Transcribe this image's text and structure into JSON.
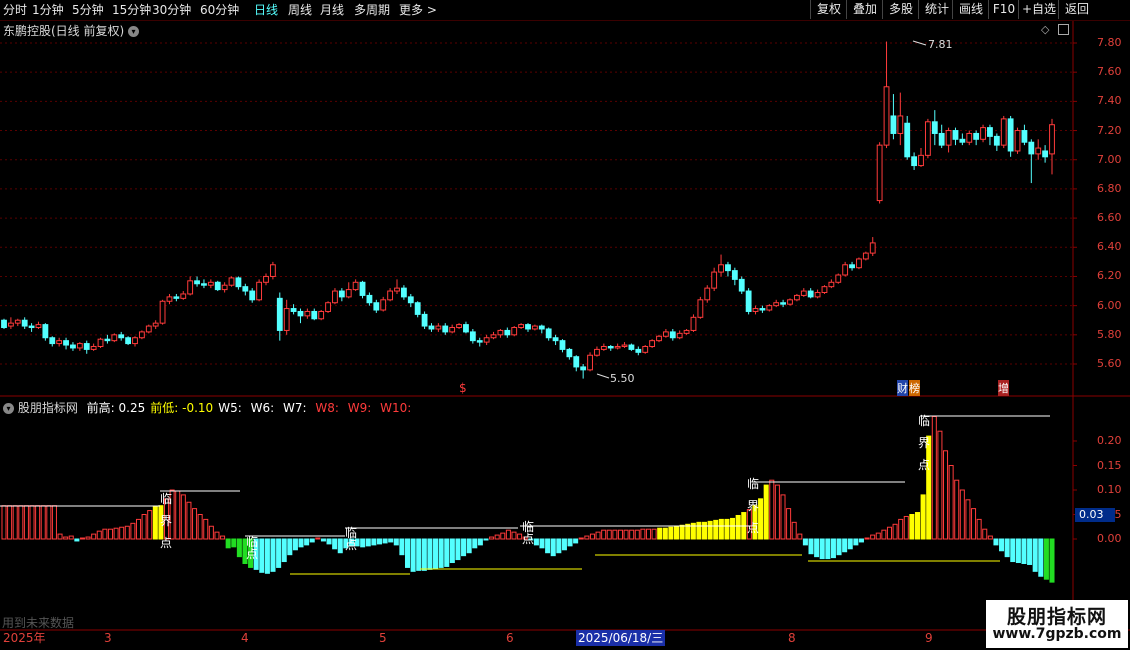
{
  "colors": {
    "bg": "#000000",
    "up": "#ff3b3b",
    "down": "#54ffff",
    "grid": "#5a0000",
    "axis": "#e0403a",
    "yellow": "#ffff00",
    "green": "#22dd22",
    "white": "#ffffff"
  },
  "toolbar": {
    "periods": [
      "分时",
      "1分钟",
      "5分钟",
      "15分钟",
      "30分钟",
      "60分钟",
      "日线",
      "周线",
      "月线",
      "多周期",
      "更多 >"
    ],
    "active_period": "日线",
    "right_buttons": [
      "复权",
      "叠加",
      "多股",
      "统计",
      "画线",
      "F10",
      "+自选",
      "返回"
    ]
  },
  "icons": {
    "menu": "chevron-down-icon",
    "diamond": "diamond-icon",
    "square": "square-icon"
  },
  "main_chart": {
    "title": "东鹏控股(日线 前复权)",
    "y_labels": [
      "7.80",
      "7.60",
      "7.40",
      "7.20",
      "7.00",
      "6.80",
      "6.60",
      "6.40",
      "6.20",
      "6.00",
      "5.80",
      "5.60"
    ],
    "high_label": "7.81",
    "low_label": "5.50",
    "markers": [
      {
        "text": "$"
      },
      {
        "text": "财"
      },
      {
        "text": "榜"
      },
      {
        "text": "增"
      }
    ]
  },
  "indicator": {
    "name": "股朋指标网",
    "items": [
      {
        "label": "前高:",
        "value": "0.25"
      },
      {
        "label": "前低:",
        "value": "-0.10"
      },
      {
        "label": "W5:",
        "value": ""
      },
      {
        "label": "W6:",
        "value": ""
      },
      {
        "label": "W7:",
        "value": ""
      },
      {
        "label": "W8:",
        "value": ""
      },
      {
        "label": "W9:",
        "value": ""
      },
      {
        "label": "W10:",
        "value": ""
      }
    ],
    "y_labels": [
      "0.20",
      "0.15",
      "0.10",
      "0.05",
      "0.00"
    ],
    "current_value": "0.03",
    "marks": [
      "临",
      "界",
      "点"
    ],
    "footer_note": "用到未来数据"
  },
  "date_axis": {
    "labels": [
      "2025年",
      "3",
      "4",
      "5",
      "6",
      "2025/06/18/三",
      "8",
      "9"
    ]
  },
  "watermark": {
    "line1": "股朋指标网",
    "line2": "www.7gpzb.com"
  },
  "chart_data": {
    "type": "candlestick",
    "series": [
      {
        "o": 5.9,
        "c": 5.85,
        "h": 5.91,
        "l": 5.84
      },
      {
        "o": 5.86,
        "c": 5.88,
        "h": 5.92,
        "l": 5.84
      },
      {
        "o": 5.88,
        "c": 5.9,
        "h": 5.91,
        "l": 5.86
      },
      {
        "o": 5.9,
        "c": 5.86,
        "h": 5.92,
        "l": 5.84
      },
      {
        "o": 5.86,
        "c": 5.85,
        "h": 5.88,
        "l": 5.82
      },
      {
        "o": 5.85,
        "c": 5.87,
        "h": 5.89,
        "l": 5.84
      },
      {
        "o": 5.87,
        "c": 5.78,
        "h": 5.88,
        "l": 5.76
      },
      {
        "o": 5.78,
        "c": 5.74,
        "h": 5.79,
        "l": 5.72
      },
      {
        "o": 5.74,
        "c": 5.76,
        "h": 5.78,
        "l": 5.72
      },
      {
        "o": 5.76,
        "c": 5.73,
        "h": 5.78,
        "l": 5.7
      },
      {
        "o": 5.73,
        "c": 5.71,
        "h": 5.75,
        "l": 5.69
      },
      {
        "o": 5.71,
        "c": 5.74,
        "h": 5.75,
        "l": 5.69
      },
      {
        "o": 5.74,
        "c": 5.7,
        "h": 5.76,
        "l": 5.67
      },
      {
        "o": 5.7,
        "c": 5.72,
        "h": 5.74,
        "l": 5.69
      },
      {
        "o": 5.72,
        "c": 5.77,
        "h": 5.78,
        "l": 5.71
      },
      {
        "o": 5.77,
        "c": 5.76,
        "h": 5.8,
        "l": 5.74
      },
      {
        "o": 5.76,
        "c": 5.8,
        "h": 5.81,
        "l": 5.75
      },
      {
        "o": 5.8,
        "c": 5.78,
        "h": 5.82,
        "l": 5.76
      },
      {
        "o": 5.78,
        "c": 5.74,
        "h": 5.79,
        "l": 5.73
      },
      {
        "o": 5.74,
        "c": 5.78,
        "h": 5.79,
        "l": 5.72
      },
      {
        "o": 5.78,
        "c": 5.82,
        "h": 5.83,
        "l": 5.77
      },
      {
        "o": 5.82,
        "c": 5.86,
        "h": 5.87,
        "l": 5.81
      },
      {
        "o": 5.86,
        "c": 5.88,
        "h": 5.9,
        "l": 5.84
      },
      {
        "o": 5.88,
        "c": 6.03,
        "h": 6.04,
        "l": 5.87
      },
      {
        "o": 6.03,
        "c": 6.06,
        "h": 6.08,
        "l": 6.01
      },
      {
        "o": 6.06,
        "c": 6.05,
        "h": 6.08,
        "l": 6.03
      },
      {
        "o": 6.05,
        "c": 6.08,
        "h": 6.1,
        "l": 6.04
      },
      {
        "o": 6.08,
        "c": 6.17,
        "h": 6.2,
        "l": 6.07
      },
      {
        "o": 6.17,
        "c": 6.15,
        "h": 6.2,
        "l": 6.13
      },
      {
        "o": 6.15,
        "c": 6.14,
        "h": 6.18,
        "l": 6.12
      },
      {
        "o": 6.14,
        "c": 6.16,
        "h": 6.18,
        "l": 6.12
      },
      {
        "o": 6.16,
        "c": 6.11,
        "h": 6.17,
        "l": 6.1
      },
      {
        "o": 6.11,
        "c": 6.14,
        "h": 6.16,
        "l": 6.09
      },
      {
        "o": 6.14,
        "c": 6.19,
        "h": 6.2,
        "l": 6.13
      },
      {
        "o": 6.19,
        "c": 6.13,
        "h": 6.2,
        "l": 6.11
      },
      {
        "o": 6.13,
        "c": 6.1,
        "h": 6.15,
        "l": 6.07
      },
      {
        "o": 6.1,
        "c": 6.04,
        "h": 6.12,
        "l": 6.02
      },
      {
        "o": 6.04,
        "c": 6.16,
        "h": 6.18,
        "l": 6.03
      },
      {
        "o": 6.16,
        "c": 6.2,
        "h": 6.22,
        "l": 6.14
      },
      {
        "o": 6.2,
        "c": 6.28,
        "h": 6.3,
        "l": 6.18
      },
      {
        "o": 6.05,
        "c": 5.83,
        "h": 6.09,
        "l": 5.76
      },
      {
        "o": 5.83,
        "c": 5.98,
        "h": 6.04,
        "l": 5.8
      },
      {
        "o": 5.98,
        "c": 5.96,
        "h": 6.01,
        "l": 5.94
      },
      {
        "o": 5.96,
        "c": 5.93,
        "h": 5.98,
        "l": 5.88
      },
      {
        "o": 5.93,
        "c": 5.96,
        "h": 5.98,
        "l": 5.91
      },
      {
        "o": 5.96,
        "c": 5.91,
        "h": 5.98,
        "l": 5.9
      },
      {
        "o": 5.91,
        "c": 5.96,
        "h": 5.97,
        "l": 5.9
      },
      {
        "o": 5.96,
        "c": 6.02,
        "h": 6.03,
        "l": 5.95
      },
      {
        "o": 6.02,
        "c": 6.1,
        "h": 6.12,
        "l": 6.01
      },
      {
        "o": 6.1,
        "c": 6.06,
        "h": 6.12,
        "l": 6.03
      },
      {
        "o": 6.06,
        "c": 6.11,
        "h": 6.16,
        "l": 6.05
      },
      {
        "o": 6.11,
        "c": 6.16,
        "h": 6.18,
        "l": 6.1
      },
      {
        "o": 6.16,
        "c": 6.07,
        "h": 6.17,
        "l": 6.05
      },
      {
        "o": 6.07,
        "c": 6.02,
        "h": 6.09,
        "l": 6.0
      },
      {
        "o": 6.02,
        "c": 5.97,
        "h": 6.04,
        "l": 5.95
      },
      {
        "o": 5.97,
        "c": 6.04,
        "h": 6.06,
        "l": 5.96
      },
      {
        "o": 6.04,
        "c": 6.1,
        "h": 6.12,
        "l": 6.03
      },
      {
        "o": 6.1,
        "c": 6.12,
        "h": 6.18,
        "l": 6.08
      },
      {
        "o": 6.12,
        "c": 6.06,
        "h": 6.14,
        "l": 6.04
      },
      {
        "o": 6.06,
        "c": 6.02,
        "h": 6.08,
        "l": 5.99
      },
      {
        "o": 6.02,
        "c": 5.94,
        "h": 6.03,
        "l": 5.92
      },
      {
        "o": 5.94,
        "c": 5.86,
        "h": 5.96,
        "l": 5.84
      },
      {
        "o": 5.86,
        "c": 5.84,
        "h": 5.88,
        "l": 5.82
      },
      {
        "o": 5.84,
        "c": 5.86,
        "h": 5.88,
        "l": 5.82
      },
      {
        "o": 5.86,
        "c": 5.82,
        "h": 5.88,
        "l": 5.8
      },
      {
        "o": 5.82,
        "c": 5.85,
        "h": 5.87,
        "l": 5.81
      },
      {
        "o": 5.85,
        "c": 5.87,
        "h": 5.88,
        "l": 5.84
      },
      {
        "o": 5.87,
        "c": 5.82,
        "h": 5.89,
        "l": 5.81
      },
      {
        "o": 5.82,
        "c": 5.76,
        "h": 5.84,
        "l": 5.74
      },
      {
        "o": 5.76,
        "c": 5.75,
        "h": 5.78,
        "l": 5.72
      },
      {
        "o": 5.75,
        "c": 5.78,
        "h": 5.8,
        "l": 5.73
      },
      {
        "o": 5.78,
        "c": 5.8,
        "h": 5.82,
        "l": 5.77
      },
      {
        "o": 5.8,
        "c": 5.83,
        "h": 5.84,
        "l": 5.78
      },
      {
        "o": 5.83,
        "c": 5.8,
        "h": 5.85,
        "l": 5.78
      },
      {
        "o": 5.8,
        "c": 5.85,
        "h": 5.86,
        "l": 5.79
      },
      {
        "o": 5.85,
        "c": 5.87,
        "h": 5.88,
        "l": 5.84
      },
      {
        "o": 5.87,
        "c": 5.84,
        "h": 5.88,
        "l": 5.82
      },
      {
        "o": 5.84,
        "c": 5.86,
        "h": 5.87,
        "l": 5.83
      },
      {
        "o": 5.86,
        "c": 5.84,
        "h": 5.87,
        "l": 5.81
      },
      {
        "o": 5.84,
        "c": 5.78,
        "h": 5.85,
        "l": 5.76
      },
      {
        "o": 5.78,
        "c": 5.76,
        "h": 5.8,
        "l": 5.73
      },
      {
        "o": 5.76,
        "c": 5.7,
        "h": 5.77,
        "l": 5.68
      },
      {
        "o": 5.7,
        "c": 5.65,
        "h": 5.71,
        "l": 5.63
      },
      {
        "o": 5.65,
        "c": 5.58,
        "h": 5.66,
        "l": 5.55
      },
      {
        "o": 5.58,
        "c": 5.56,
        "h": 5.6,
        "l": 5.5
      },
      {
        "o": 5.56,
        "c": 5.66,
        "h": 5.68,
        "l": 5.55
      },
      {
        "o": 5.66,
        "c": 5.7,
        "h": 5.72,
        "l": 5.65
      },
      {
        "o": 5.7,
        "c": 5.72,
        "h": 5.74,
        "l": 5.69
      },
      {
        "o": 5.72,
        "c": 5.71,
        "h": 5.73,
        "l": 5.69
      },
      {
        "o": 5.71,
        "c": 5.72,
        "h": 5.74,
        "l": 5.7
      },
      {
        "o": 5.72,
        "c": 5.73,
        "h": 5.75,
        "l": 5.71
      },
      {
        "o": 5.73,
        "c": 5.7,
        "h": 5.74,
        "l": 5.69
      },
      {
        "o": 5.7,
        "c": 5.68,
        "h": 5.72,
        "l": 5.66
      },
      {
        "o": 5.68,
        "c": 5.72,
        "h": 5.73,
        "l": 5.67
      },
      {
        "o": 5.72,
        "c": 5.76,
        "h": 5.77,
        "l": 5.71
      },
      {
        "o": 5.76,
        "c": 5.79,
        "h": 5.8,
        "l": 5.75
      },
      {
        "o": 5.79,
        "c": 5.82,
        "h": 5.84,
        "l": 5.78
      },
      {
        "o": 5.82,
        "c": 5.78,
        "h": 5.84,
        "l": 5.76
      },
      {
        "o": 5.78,
        "c": 5.81,
        "h": 5.83,
        "l": 5.77
      },
      {
        "o": 5.81,
        "c": 5.83,
        "h": 5.84,
        "l": 5.8
      },
      {
        "o": 5.83,
        "c": 5.92,
        "h": 5.94,
        "l": 5.82
      },
      {
        "o": 5.92,
        "c": 6.04,
        "h": 6.06,
        "l": 5.91
      },
      {
        "o": 6.04,
        "c": 6.12,
        "h": 6.14,
        "l": 6.02
      },
      {
        "o": 6.12,
        "c": 6.23,
        "h": 6.26,
        "l": 6.1
      },
      {
        "o": 6.23,
        "c": 6.28,
        "h": 6.35,
        "l": 6.2
      },
      {
        "o": 6.28,
        "c": 6.24,
        "h": 6.3,
        "l": 6.2
      },
      {
        "o": 6.24,
        "c": 6.18,
        "h": 6.26,
        "l": 6.14
      },
      {
        "o": 6.18,
        "c": 6.1,
        "h": 6.2,
        "l": 6.08
      },
      {
        "o": 6.1,
        "c": 5.96,
        "h": 6.12,
        "l": 5.94
      },
      {
        "o": 5.96,
        "c": 5.98,
        "h": 6.0,
        "l": 5.94
      },
      {
        "o": 5.98,
        "c": 5.97,
        "h": 6.0,
        "l": 5.95
      },
      {
        "o": 5.97,
        "c": 6.0,
        "h": 6.01,
        "l": 5.96
      },
      {
        "o": 6.0,
        "c": 6.02,
        "h": 6.04,
        "l": 5.99
      },
      {
        "o": 6.02,
        "c": 6.01,
        "h": 6.04,
        "l": 5.99
      },
      {
        "o": 6.01,
        "c": 6.04,
        "h": 6.05,
        "l": 6.0
      },
      {
        "o": 6.04,
        "c": 6.07,
        "h": 6.08,
        "l": 6.03
      },
      {
        "o": 6.07,
        "c": 6.1,
        "h": 6.12,
        "l": 6.06
      },
      {
        "o": 6.1,
        "c": 6.06,
        "h": 6.12,
        "l": 6.05
      },
      {
        "o": 6.06,
        "c": 6.09,
        "h": 6.11,
        "l": 6.05
      },
      {
        "o": 6.09,
        "c": 6.13,
        "h": 6.14,
        "l": 6.08
      },
      {
        "o": 6.13,
        "c": 6.16,
        "h": 6.18,
        "l": 6.12
      },
      {
        "o": 6.16,
        "c": 6.21,
        "h": 6.22,
        "l": 6.15
      },
      {
        "o": 6.21,
        "c": 6.28,
        "h": 6.3,
        "l": 6.2
      },
      {
        "o": 6.28,
        "c": 6.26,
        "h": 6.3,
        "l": 6.24
      },
      {
        "o": 6.26,
        "c": 6.32,
        "h": 6.33,
        "l": 6.25
      },
      {
        "o": 6.32,
        "c": 6.36,
        "h": 6.37,
        "l": 6.31
      },
      {
        "o": 6.36,
        "c": 6.43,
        "h": 6.47,
        "l": 6.34
      },
      {
        "o": 6.72,
        "c": 7.1,
        "h": 7.12,
        "l": 6.7
      },
      {
        "o": 7.1,
        "c": 7.5,
        "h": 7.81,
        "l": 7.08
      },
      {
        "o": 7.3,
        "c": 7.18,
        "h": 7.45,
        "l": 7.14
      },
      {
        "o": 7.18,
        "c": 7.3,
        "h": 7.46,
        "l": 7.1
      },
      {
        "o": 7.25,
        "c": 7.02,
        "h": 7.3,
        "l": 7.0
      },
      {
        "o": 7.02,
        "c": 6.96,
        "h": 7.05,
        "l": 6.93
      },
      {
        "o": 6.96,
        "c": 7.03,
        "h": 7.08,
        "l": 6.95
      },
      {
        "o": 7.03,
        "c": 7.26,
        "h": 7.28,
        "l": 7.01
      },
      {
        "o": 7.26,
        "c": 7.18,
        "h": 7.34,
        "l": 7.1
      },
      {
        "o": 7.18,
        "c": 7.1,
        "h": 7.24,
        "l": 7.08
      },
      {
        "o": 7.1,
        "c": 7.2,
        "h": 7.22,
        "l": 7.05
      },
      {
        "o": 7.2,
        "c": 7.14,
        "h": 7.22,
        "l": 7.1
      },
      {
        "o": 7.14,
        "c": 7.12,
        "h": 7.18,
        "l": 7.1
      },
      {
        "o": 7.12,
        "c": 7.18,
        "h": 7.2,
        "l": 7.1
      },
      {
        "o": 7.18,
        "c": 7.14,
        "h": 7.2,
        "l": 7.1
      },
      {
        "o": 7.14,
        "c": 7.22,
        "h": 7.24,
        "l": 7.12
      },
      {
        "o": 7.22,
        "c": 7.16,
        "h": 7.24,
        "l": 7.1
      },
      {
        "o": 7.16,
        "c": 7.1,
        "h": 7.18,
        "l": 7.06
      },
      {
        "o": 7.1,
        "c": 7.28,
        "h": 7.3,
        "l": 7.08
      },
      {
        "o": 7.28,
        "c": 7.06,
        "h": 7.3,
        "l": 7.02
      },
      {
        "o": 7.06,
        "c": 7.2,
        "h": 7.22,
        "l": 7.04
      },
      {
        "o": 7.2,
        "c": 7.12,
        "h": 7.24,
        "l": 7.1
      },
      {
        "o": 7.12,
        "c": 7.04,
        "h": 7.14,
        "l": 6.84
      },
      {
        "o": 7.04,
        "c": 7.08,
        "h": 7.14,
        "l": 7.0
      },
      {
        "o": 7.06,
        "c": 7.02,
        "h": 7.1,
        "l": 6.98
      },
      {
        "o": 7.04,
        "c": 7.24,
        "h": 7.28,
        "l": 6.9
      }
    ],
    "ylim": [
      5.45,
      7.86
    ],
    "indicator_bars": [
      0.068,
      0.068,
      0.068,
      0.068,
      0.068,
      0.068,
      0.068,
      0.068,
      0.068,
      0.068,
      0.01,
      0.004,
      0.006,
      -0.004,
      0.002,
      0.004,
      0.01,
      0.016,
      0.02,
      0.02,
      0.022,
      0.024,
      0.026,
      0.032,
      0.04,
      0.05,
      0.058,
      0.066,
      0.068,
      0.082,
      0.1,
      0.098,
      0.09,
      0.075,
      0.062,
      0.05,
      0.04,
      0.026,
      0.014,
      0.006,
      -0.018,
      -0.016,
      -0.036,
      -0.05,
      -0.058,
      -0.062,
      -0.068,
      -0.07,
      -0.066,
      -0.058,
      -0.046,
      -0.032,
      -0.022,
      -0.016,
      -0.012,
      -0.006,
      0.002,
      -0.004,
      -0.01,
      -0.02,
      -0.028,
      -0.018,
      -0.014,
      -0.014,
      -0.016,
      -0.014,
      -0.012,
      -0.01,
      -0.008,
      -0.006,
      -0.012,
      -0.032,
      -0.058,
      -0.066,
      -0.064,
      -0.064,
      -0.062,
      -0.06,
      -0.058,
      -0.056,
      -0.048,
      -0.042,
      -0.034,
      -0.028,
      -0.018,
      -0.012,
      -0.002,
      0.004,
      0.008,
      0.012,
      0.018,
      0.014,
      0.01,
      0.004,
      -0.002,
      -0.012,
      -0.018,
      -0.028,
      -0.034,
      -0.028,
      -0.022,
      -0.014,
      -0.008,
      0.002,
      0.006,
      0.01,
      0.014,
      0.018,
      0.018,
      0.018,
      0.018,
      0.018,
      0.018,
      0.018,
      0.02,
      0.02,
      0.02,
      0.022,
      0.022,
      0.024,
      0.026,
      0.028,
      0.03,
      0.032,
      0.034,
      0.034,
      0.036,
      0.038,
      0.04,
      0.04,
      0.042,
      0.048,
      0.054,
      0.06,
      0.068,
      0.082,
      0.11,
      0.12,
      0.11,
      0.09,
      0.062,
      0.034,
      0.01,
      -0.012,
      -0.03,
      -0.036,
      -0.04,
      -0.04,
      -0.038,
      -0.032,
      -0.026,
      -0.02,
      -0.012,
      -0.006,
      0.002,
      0.008,
      0.012,
      0.018,
      0.024,
      0.03,
      0.04,
      0.046,
      0.05,
      0.054,
      0.09,
      0.21,
      0.25,
      0.22,
      0.18,
      0.15,
      0.12,
      0.1,
      0.08,
      0.062,
      0.04,
      0.02,
      0.006,
      -0.012,
      -0.024,
      -0.036,
      -0.046,
      -0.048,
      -0.05,
      -0.052,
      -0.066,
      -0.076,
      -0.082,
      -0.088
    ]
  }
}
